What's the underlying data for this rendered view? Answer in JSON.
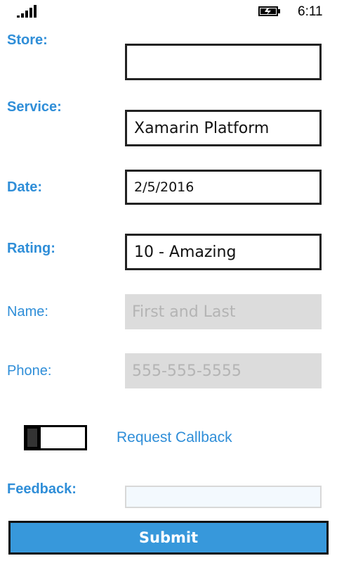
{
  "status_bar": {
    "time": "6:11",
    "signal_icon": "signal-strength-icon",
    "battery_icon": "battery-charging-icon"
  },
  "form": {
    "store": {
      "label": "Store:",
      "value": ""
    },
    "service": {
      "label": "Service:",
      "value": "Xamarin Platform"
    },
    "date": {
      "label": "Date:",
      "value": "2/5/2016"
    },
    "rating": {
      "label": "Rating:",
      "value": "10 - Amazing"
    },
    "name": {
      "label": "Name:",
      "placeholder": "First and Last"
    },
    "phone": {
      "label": "Phone:",
      "placeholder": "555-555-5555"
    },
    "callback": {
      "label": "Request Callback",
      "checked": false
    },
    "feedback": {
      "label": "Feedback:",
      "value": ""
    }
  },
  "submit": {
    "label": "Submit"
  },
  "colors": {
    "accent": "#2f8ed8",
    "button": "#3798db",
    "disabled_bg": "#dcdcdc",
    "disabled_text": "#b4b4b4"
  }
}
